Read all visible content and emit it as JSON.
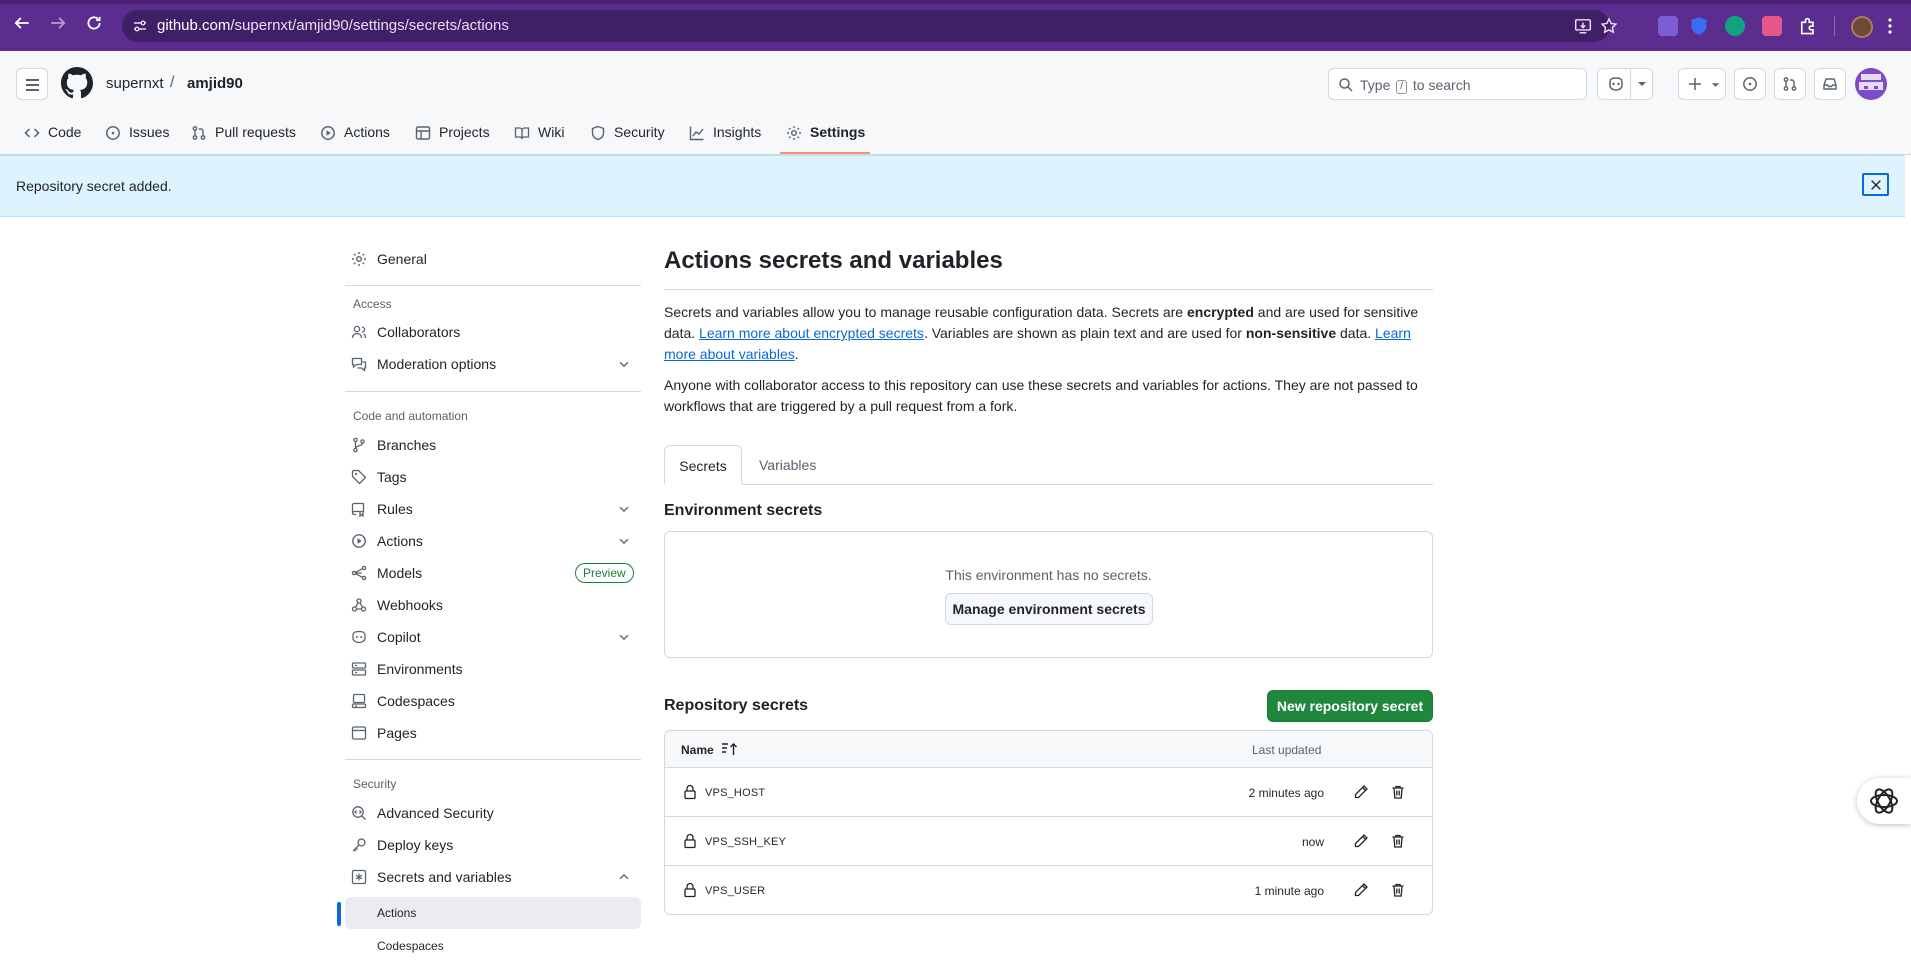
{
  "browser": {
    "url_host": "github.com",
    "url_path": "/supernxt/amjid90/settings/secrets/actions"
  },
  "header": {
    "owner": "supernxt",
    "separator": "/",
    "repo": "amjid90",
    "search_before": "Type",
    "search_key": "/",
    "search_after": "to search"
  },
  "repo_tabs": [
    {
      "label": "Code",
      "icon": "code-icon"
    },
    {
      "label": "Issues",
      "icon": "issue-opened-icon"
    },
    {
      "label": "Pull requests",
      "icon": "git-pull-request-icon"
    },
    {
      "label": "Actions",
      "icon": "play-icon"
    },
    {
      "label": "Projects",
      "icon": "table-icon"
    },
    {
      "label": "Wiki",
      "icon": "book-icon"
    },
    {
      "label": "Security",
      "icon": "shield-icon"
    },
    {
      "label": "Insights",
      "icon": "graph-icon"
    },
    {
      "label": "Settings",
      "icon": "gear-icon",
      "active": true
    }
  ],
  "flash": {
    "message": "Repository secret added."
  },
  "sidebar": {
    "general": "General",
    "access_heading": "Access",
    "collaborators": "Collaborators",
    "moderation": "Moderation options",
    "code_heading": "Code and automation",
    "branches": "Branches",
    "tags": "Tags",
    "rules": "Rules",
    "actions": "Actions",
    "models": "Models",
    "preview_badge": "Preview",
    "webhooks": "Webhooks",
    "copilot": "Copilot",
    "environments": "Environments",
    "codespaces": "Codespaces",
    "pages": "Pages",
    "security_heading": "Security",
    "advanced_security": "Advanced Security",
    "deploy_keys": "Deploy keys",
    "secrets_vars": "Secrets and variables",
    "sub_actions": "Actions",
    "sub_codespaces": "Codespaces"
  },
  "main": {
    "title": "Actions secrets and variables",
    "desc1_a": "Secrets and variables allow you to manage reusable configuration data. Secrets are ",
    "desc1_b": "encrypted",
    "desc1_c": " and are used for sensitive data. ",
    "desc1_link1": "Learn more about encrypted secrets",
    "desc1_d": ". Variables are shown as plain text and are used for ",
    "desc1_e": "non-sensitive",
    "desc1_f": " data. ",
    "desc1_link2": "Learn more about variables",
    "desc1_g": ".",
    "desc2": "Anyone with collaborator access to this repository can use these secrets and variables for actions. They are not passed to workflows that are triggered by a pull request from a fork.",
    "tab_secrets": "Secrets",
    "tab_variables": "Variables",
    "env_heading": "Environment secrets",
    "env_empty": "This environment has no secrets.",
    "manage_env_btn": "Manage environment secrets",
    "repo_heading": "Repository secrets",
    "new_secret_btn": "New repository secret",
    "col_name": "Name",
    "col_updated": "Last updated",
    "secrets": [
      {
        "name": "VPS_HOST",
        "updated": "2 minutes ago"
      },
      {
        "name": "VPS_SSH_KEY",
        "updated": "now"
      },
      {
        "name": "VPS_USER",
        "updated": "1 minute ago"
      }
    ]
  },
  "colors": {
    "browser_bar": "#5b2d8e",
    "flash_bg": "#ddf4ff",
    "primary_button": "#1f883d",
    "link": "#0969da",
    "tab_underline": "#fd8c73"
  }
}
